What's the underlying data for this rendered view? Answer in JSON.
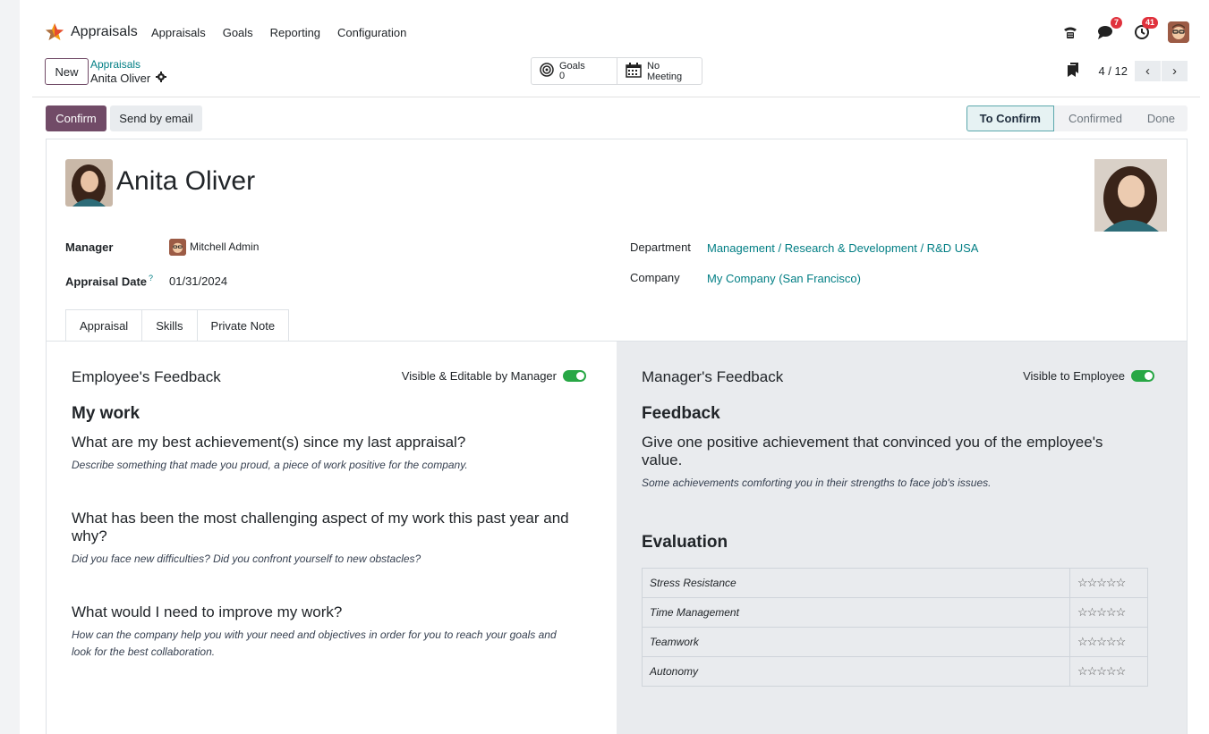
{
  "navbar": {
    "app_name": "Appraisals",
    "menu": [
      "Appraisals",
      "Goals",
      "Reporting",
      "Configuration"
    ],
    "chat_badge": "7",
    "activity_badge": "41"
  },
  "control_panel": {
    "new_label": "New",
    "breadcrumb_parent": "Appraisals",
    "breadcrumb_current": "Anita Oliver",
    "goals_label": "Goals",
    "goals_count": "0",
    "meeting_label": "No Meeting",
    "pager": "4 / 12"
  },
  "statusbar": {
    "confirm_label": "Confirm",
    "email_label": "Send by email",
    "stages": [
      "To Confirm",
      "Confirmed",
      "Done"
    ],
    "active_stage": "To Confirm"
  },
  "form": {
    "employee_name": "Anita Oliver",
    "manager_label": "Manager",
    "manager_value": "Mitchell Admin",
    "date_label": "Appraisal Date",
    "date_help": "?",
    "date_value": "01/31/2024",
    "department_label": "Department",
    "department_value": "Management / Research & Development / R&D USA",
    "company_label": "Company",
    "company_value": "My Company (San Francisco)"
  },
  "tabs": [
    "Appraisal",
    "Skills",
    "Private Note"
  ],
  "employee_feedback": {
    "title": "Employee's Feedback",
    "toggle_label": "Visible & Editable by Manager",
    "section": "My work",
    "q1": "What are my best achievement(s) since my last appraisal?",
    "h1": "Describe something that made you proud, a piece of work positive for the company.",
    "q2": "What has been the most challenging aspect of my work this past year and why?",
    "h2": "Did you face new difficulties? Did you confront yourself to new obstacles?",
    "q3": "What would I need to improve my work?",
    "h3": "How can the company help you with your need and objectives in order for you to reach your goals and look for the best collaboration."
  },
  "manager_feedback": {
    "title": "Manager's Feedback",
    "toggle_label": "Visible to Employee",
    "section": "Feedback",
    "q1": "Give one positive achievement that convinced you of the employee's value.",
    "h1": "Some achievements comforting you in their strengths to face job's issues.",
    "evaluation_title": "Evaluation",
    "evaluation": [
      {
        "label": "Stress Resistance",
        "stars": "☆☆☆☆☆"
      },
      {
        "label": "Time Management",
        "stars": "☆☆☆☆☆"
      },
      {
        "label": "Teamwork",
        "stars": "☆☆☆☆☆"
      },
      {
        "label": "Autonomy",
        "stars": "☆☆☆☆☆"
      }
    ]
  },
  "colors": {
    "primary": "#714b67",
    "link": "#017e84",
    "toggle_on": "#28a745",
    "badge": "#e0313c"
  }
}
